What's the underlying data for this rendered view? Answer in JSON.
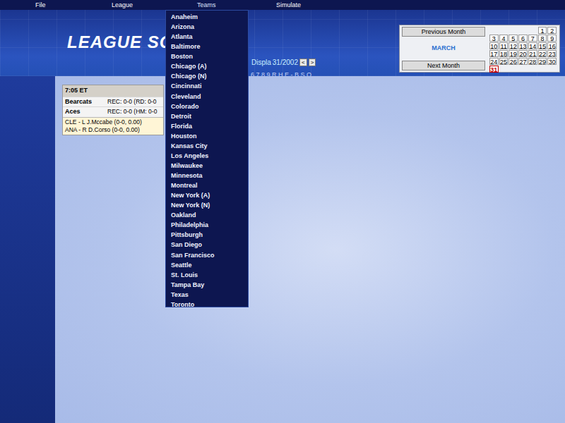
{
  "menu": [
    {
      "label": "File",
      "selected": false
    },
    {
      "label": "League",
      "selected": false
    },
    {
      "label": "Teams",
      "selected": true
    },
    {
      "label": "Simulate",
      "selected": false
    }
  ],
  "header": {
    "title": "LEAGUE SC",
    "subtitle": "Displa",
    "date": "31/2002",
    "prev": "<",
    "next": ">",
    "scoreboard_columns": "6789RHE-BSO"
  },
  "calendar": {
    "prev_button": "Previous Month",
    "next_button": "Next Month",
    "month": "MARCH",
    "days": [
      {
        "day": "",
        "selected": false
      },
      {
        "day": "",
        "selected": false
      },
      {
        "day": "",
        "selected": false
      },
      {
        "day": "",
        "selected": false
      },
      {
        "day": "",
        "selected": false
      },
      {
        "day": "1",
        "selected": false
      },
      {
        "day": "2",
        "selected": false
      },
      {
        "day": "3",
        "selected": false
      },
      {
        "day": "4",
        "selected": false
      },
      {
        "day": "5",
        "selected": false
      },
      {
        "day": "6",
        "selected": false
      },
      {
        "day": "7",
        "selected": false
      },
      {
        "day": "8",
        "selected": false
      },
      {
        "day": "9",
        "selected": false
      },
      {
        "day": "10",
        "selected": false
      },
      {
        "day": "11",
        "selected": false
      },
      {
        "day": "12",
        "selected": false
      },
      {
        "day": "13",
        "selected": false
      },
      {
        "day": "14",
        "selected": false
      },
      {
        "day": "15",
        "selected": false
      },
      {
        "day": "16",
        "selected": false
      },
      {
        "day": "17",
        "selected": false
      },
      {
        "day": "18",
        "selected": false
      },
      {
        "day": "19",
        "selected": false
      },
      {
        "day": "20",
        "selected": false
      },
      {
        "day": "21",
        "selected": false
      },
      {
        "day": "22",
        "selected": false
      },
      {
        "day": "23",
        "selected": false
      },
      {
        "day": "24",
        "selected": false
      },
      {
        "day": "25",
        "selected": false
      },
      {
        "day": "26",
        "selected": false
      },
      {
        "day": "27",
        "selected": false
      },
      {
        "day": "28",
        "selected": false
      },
      {
        "day": "29",
        "selected": false
      },
      {
        "day": "30",
        "selected": false
      },
      {
        "day": "31",
        "selected": true
      }
    ]
  },
  "game": {
    "time": "7:05 ET",
    "teams": [
      {
        "name": "Bearcats",
        "record": "REC: 0-0 (RD: 0-0"
      },
      {
        "name": "Aces",
        "record": "REC: 0-0 (HM: 0-0"
      }
    ],
    "pitchers": [
      "CLE - L J.Mccabe (0-0, 0.00)",
      "ANA - R D.Corso (0-0, 0.00)"
    ]
  },
  "teams_menu": [
    "Anaheim",
    "Arizona",
    "Atlanta",
    "Baltimore",
    "Boston",
    "Chicago (A)",
    "Chicago (N)",
    "Cincinnati",
    "Cleveland",
    "Colorado",
    "Detroit",
    "Florida",
    "Houston",
    "Kansas City",
    "Los Angeles",
    "Milwaukee",
    "Minnesota",
    "Montreal",
    "New York (A)",
    "New York (N)",
    "Oakland",
    "Philadelphia",
    "Pittsburgh",
    "San Diego",
    "San Francisco",
    "Seattle",
    "St. Louis",
    "Tampa Bay",
    "Texas",
    "Toronto"
  ]
}
